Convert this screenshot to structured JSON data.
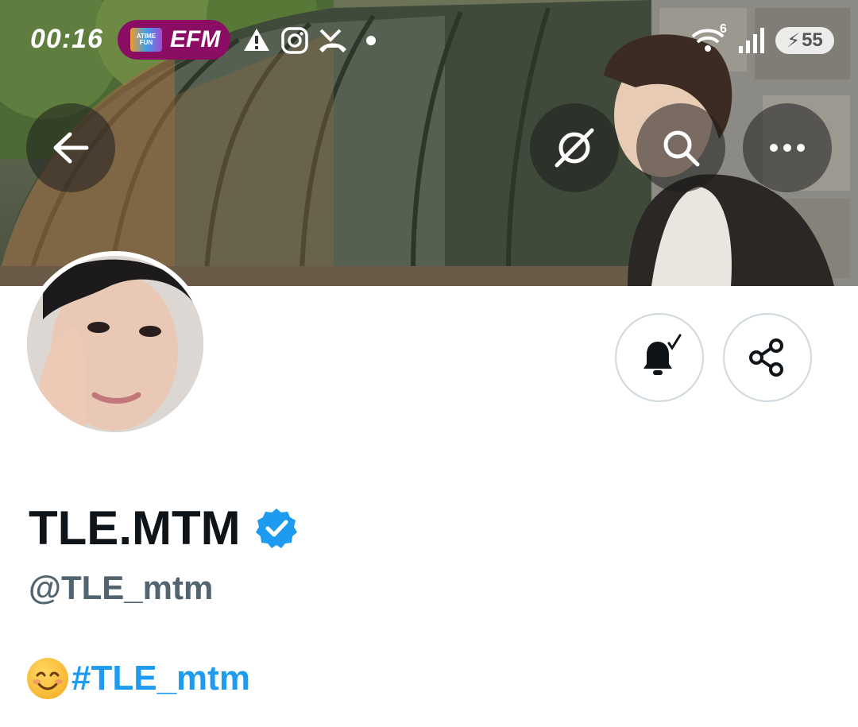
{
  "status_bar": {
    "time": "00:16",
    "notification_pill": {
      "label": "EFM",
      "logo_text": "ATIME FUN"
    },
    "signal_badge": "6",
    "battery": "55"
  },
  "profile": {
    "display_name": "TLE.MTM",
    "verified": true,
    "handle": "@TLE_mtm",
    "bio": {
      "emoji": "☺",
      "hashtag": "#TLE_mtm"
    }
  },
  "icons": {
    "back": "back-arrow-icon",
    "grok": "grok-icon",
    "search": "search-icon",
    "more": "more-icon",
    "notifications": "bell-subscribed-icon",
    "share": "share-icon",
    "verified": "verified-badge-icon"
  },
  "colors": {
    "accent": "#1d9bf0",
    "text_primary": "#0f1419",
    "text_secondary": "#536471",
    "pill": "#8b0c63",
    "button_border": "#cfd9de"
  }
}
